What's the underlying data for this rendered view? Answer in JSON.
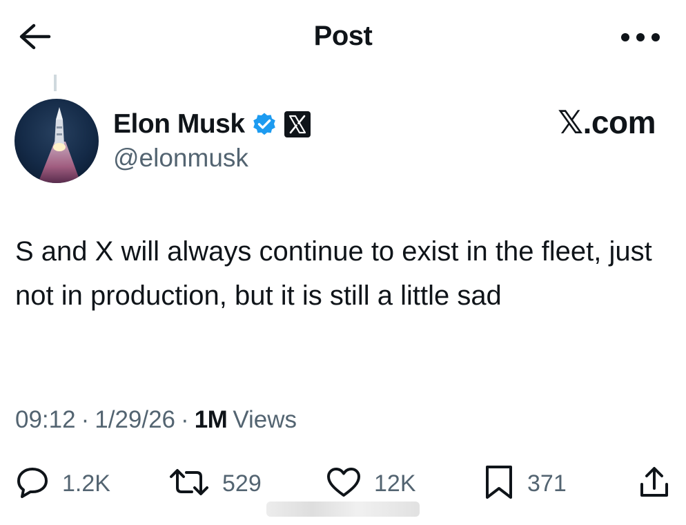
{
  "header": {
    "title": "Post",
    "back_icon": "arrow-left-icon",
    "more_icon": "more-horizontal-icon"
  },
  "author": {
    "name": "Elon Musk",
    "handle": "@elonmusk",
    "verified_icon": "verified-badge-icon",
    "affiliate_icon": "x-logo-icon",
    "avatar": "rocket-launch-avatar"
  },
  "watermark": {
    "text": "𝕏.com"
  },
  "post": {
    "text": "S and X will always continue to exist in the fleet, just not in production, but it is still a little sad"
  },
  "meta": {
    "time": "09:12",
    "separator": "·",
    "date": "1/29/26",
    "views_count": "1M",
    "views_label": "Views"
  },
  "actions": {
    "reply": {
      "icon": "reply-bubble-icon",
      "count": "1.2K"
    },
    "repost": {
      "icon": "repost-icon",
      "count": "529"
    },
    "like": {
      "icon": "heart-icon",
      "count": "12K"
    },
    "bookmark": {
      "icon": "bookmark-icon",
      "count": "371"
    },
    "share": {
      "icon": "share-icon"
    }
  },
  "colors": {
    "text_primary": "#0f1419",
    "text_secondary": "#536471",
    "verified_blue": "#1d9bf0",
    "thread_line": "#cfd9de"
  }
}
